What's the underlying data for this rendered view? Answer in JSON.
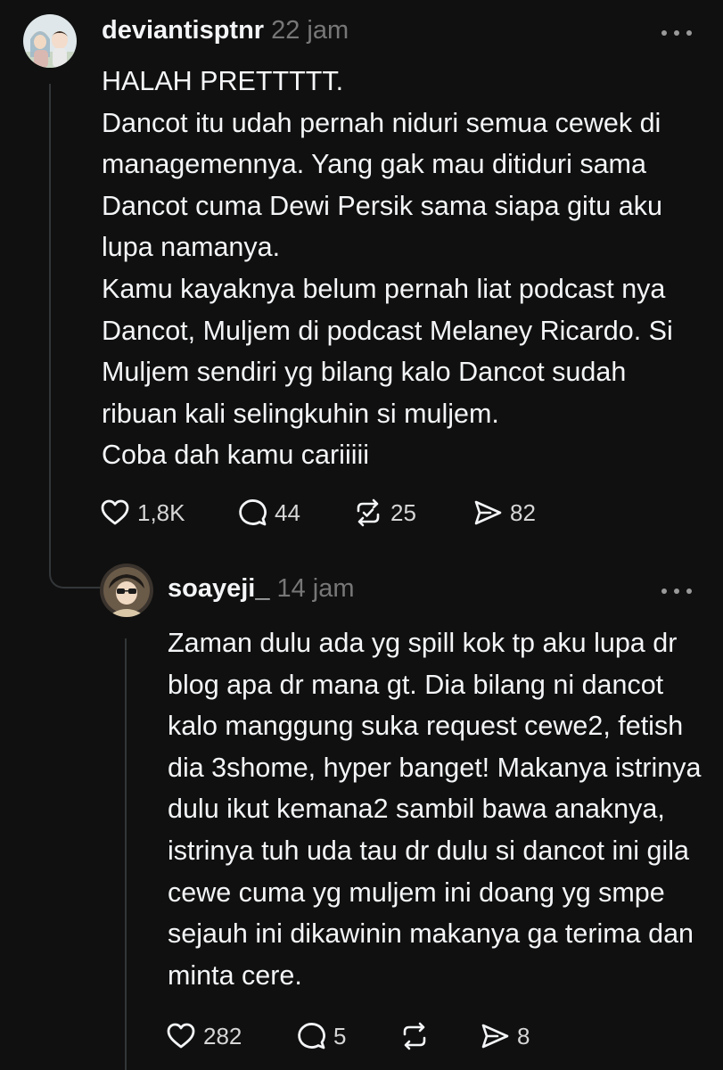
{
  "post1": {
    "username": "deviantisptnr",
    "time": "22 jam",
    "text": "HALAH PRETTTTT.\nDancot itu udah pernah niduri semua cewek di managemennya. Yang gak mau ditiduri sama Dancot cuma Dewi Persik sama siapa gitu aku lupa namanya.\nKamu kayaknya belum pernah liat podcast nya Dancot, Muljem di podcast Melaney Ricardo. Si Muljem sendiri yg bilang kalo Dancot sudah ribuan kali selingkuhin si muljem.\nCoba dah kamu cariiiii",
    "likes": "1,8K",
    "comments": "44",
    "reposts": "25",
    "shares": "82"
  },
  "post2": {
    "username": "soayeji_",
    "time": "14 jam",
    "text": "Zaman dulu ada yg spill kok tp aku lupa dr blog apa dr mana gt. Dia bilang ni dancot kalo manggung suka request cewe2, fetish dia 3shome, hyper banget! Makanya istrinya dulu ikut kemana2 sambil bawa anaknya, istrinya tuh uda tau dr dulu si dancot ini gila cewe cuma yg muljem ini doang yg smpe sejauh ini dikawinin makanya ga terima dan minta cere.",
    "likes": "282",
    "comments": "5",
    "reposts": "",
    "shares": "8"
  },
  "icons": {
    "like": "heart-icon",
    "comment": "comment-bubble-icon",
    "repost": "repost-icon",
    "share": "send-icon",
    "more": "more-options-icon"
  },
  "colors": {
    "background": "#101010",
    "text": "#f3f5f7",
    "muted": "#777777",
    "thread_line": "#333638"
  }
}
